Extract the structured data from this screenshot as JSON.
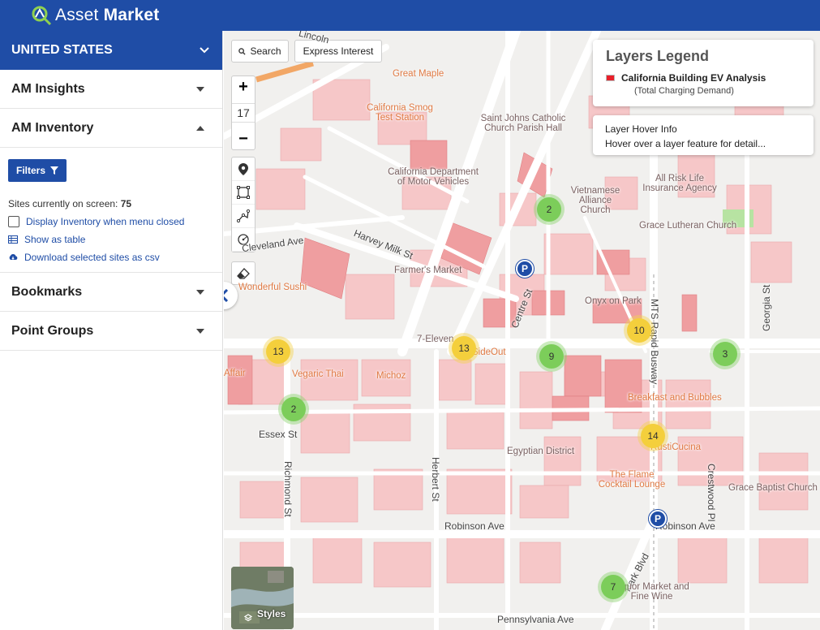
{
  "app": {
    "logo_light": "Asset",
    "logo_bold": "Market",
    "accent": "#1f4da6"
  },
  "sidebar": {
    "country": "UNITED STATES",
    "sections": [
      {
        "label": "AM Insights"
      },
      {
        "label": "AM Inventory"
      },
      {
        "label": "Bookmarks"
      },
      {
        "label": "Point Groups"
      }
    ],
    "inventory": {
      "filters_label": "Filters",
      "sites_label": "Sites currently on screen:",
      "sites_count": "75",
      "display_when_closed": "Display Inventory when menu closed",
      "show_as_table": "Show as table",
      "download_csv": "Download selected sites as csv"
    }
  },
  "map": {
    "search_label": "Search",
    "express_label": "Express Interest",
    "zoom_level": "17",
    "zoom_in": "+",
    "zoom_out": "−",
    "styles_label": "Styles",
    "legend": {
      "title": "Layers Legend",
      "layer_name": "California Building EV Analysis",
      "layer_sub": "(Total Charging Demand)",
      "swatch_color": "#e8202a"
    },
    "hover_info": {
      "title": "Layer Hover Info",
      "text": "Hover over a layer feature for detail..."
    },
    "clusters": [
      {
        "count": "2",
        "color": "green"
      },
      {
        "count": "13",
        "color": "yellow"
      },
      {
        "count": "13",
        "color": "yellow"
      },
      {
        "count": "10",
        "color": "yellow"
      },
      {
        "count": "9",
        "color": "green"
      },
      {
        "count": "3",
        "color": "green"
      },
      {
        "count": "2",
        "color": "green"
      },
      {
        "count": "14",
        "color": "yellow"
      },
      {
        "count": "7",
        "color": "green"
      }
    ],
    "parking_label": "P",
    "roads": [
      "Cleveland Ave",
      "Harvey Milk St",
      "Centre St",
      "MTS Rapid Busway",
      "Georgia St",
      "Essex St",
      "Richmond St",
      "Herbert St",
      "Robinson Ave",
      "Robinson Ave",
      "Park Blvd",
      "Crestwood Pl",
      "Pennsylvania Ave",
      "Lincoln"
    ],
    "places": [
      {
        "name": "Great Maple",
        "kind": "poi"
      },
      {
        "name": "California Smog Test Station",
        "kind": "poi"
      },
      {
        "name": "Saint Johns Catholic Church Parish Hall",
        "kind": "church"
      },
      {
        "name": "California Department of Motor Vehicles",
        "kind": "church"
      },
      {
        "name": "Vietnamese Alliance Church",
        "kind": "church"
      },
      {
        "name": "All Risk Life Insurance Agency",
        "kind": "church"
      },
      {
        "name": "Grace Lutheran Church",
        "kind": "church"
      },
      {
        "name": "Farmer's Market",
        "kind": "church"
      },
      {
        "name": "Wonderful Sushi",
        "kind": "poi"
      },
      {
        "name": "Onyx on Park",
        "kind": "church"
      },
      {
        "name": "7-Eleven",
        "kind": "church"
      },
      {
        "name": "SideOut",
        "kind": "poi"
      },
      {
        "name": "Vegaric Thai",
        "kind": "poi"
      },
      {
        "name": "Michoz",
        "kind": "poi"
      },
      {
        "name": "Breakfast and Bubbles",
        "kind": "poi"
      },
      {
        "name": "RustiCucina",
        "kind": "poi"
      },
      {
        "name": "Egyptian District",
        "kind": "church"
      },
      {
        "name": "The Flame Cocktail Lounge",
        "kind": "poi"
      },
      {
        "name": "Grace Baptist Church",
        "kind": "church"
      },
      {
        "name": "Liquor Market and Fine Wine",
        "kind": "church"
      },
      {
        "name": "Affair",
        "kind": "poi"
      }
    ]
  }
}
